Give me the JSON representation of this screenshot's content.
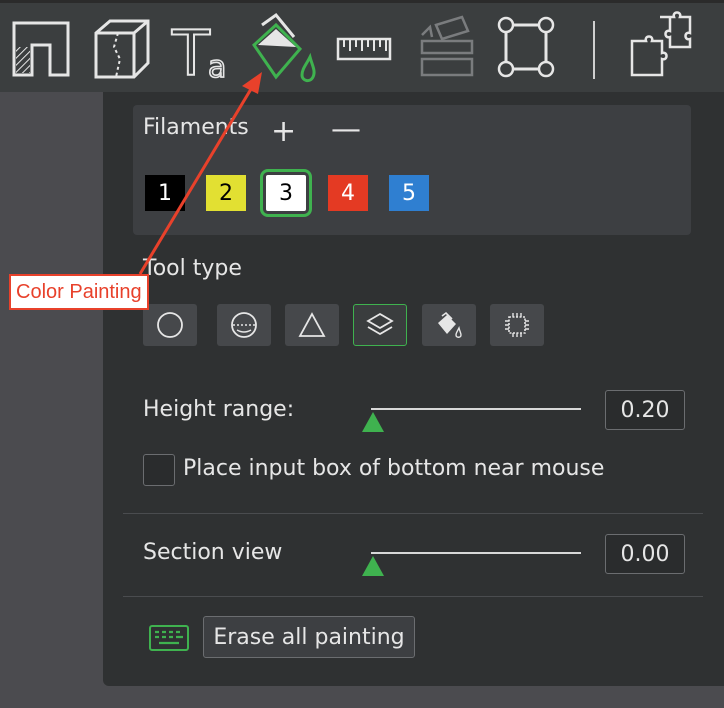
{
  "toolbar": {
    "tools": [
      {
        "name": "cut-tool",
        "icon": "cut-corner-icon"
      },
      {
        "name": "support-tool",
        "icon": "cube-seam-icon"
      },
      {
        "name": "text-tool",
        "icon": "text-ta-icon",
        "glyph_big": "T",
        "glyph_small": "a"
      },
      {
        "name": "color-painting-tool",
        "icon": "paint-bucket-icon",
        "active": true
      },
      {
        "name": "measure-tool",
        "icon": "ruler-icon"
      },
      {
        "name": "assembly-tool",
        "icon": "stacked-parts-icon"
      },
      {
        "name": "seam-tool",
        "icon": "frame-corners-icon"
      },
      {
        "name": "arrange-tool",
        "icon": "puzzle-icon"
      }
    ]
  },
  "panel": {
    "filaments": {
      "title": "Filaments",
      "add_label": "+",
      "remove_label": "—",
      "swatches": [
        {
          "label": "1",
          "bg": "#000000",
          "fg": "#ffffff",
          "selected": false
        },
        {
          "label": "2",
          "bg": "#e2e032",
          "fg": "#000000",
          "selected": false
        },
        {
          "label": "3",
          "bg": "#ffffff",
          "fg": "#000000",
          "selected": true
        },
        {
          "label": "4",
          "bg": "#e43a23",
          "fg": "#ffffff",
          "selected": false
        },
        {
          "label": "5",
          "bg": "#2f7fd1",
          "fg": "#ffffff",
          "selected": false
        }
      ]
    },
    "tool_type": {
      "label": "Tool type",
      "buttons": [
        {
          "name": "circle",
          "icon": "circle-icon",
          "active": false
        },
        {
          "name": "sphere",
          "icon": "sphere-icon",
          "active": false
        },
        {
          "name": "triangle",
          "icon": "triangle-icon",
          "active": false
        },
        {
          "name": "height-range",
          "icon": "layers-icon",
          "active": true
        },
        {
          "name": "fill",
          "icon": "fill-bucket-icon",
          "active": false
        },
        {
          "name": "gap-fill",
          "icon": "chip-icon",
          "active": false
        }
      ]
    },
    "height_range": {
      "label": "Height range:",
      "value": "0.20",
      "slider_fraction": 0.0
    },
    "checkbox": {
      "label": "Place input box of bottom near mouse",
      "checked": false
    },
    "section_view": {
      "label": "Section view",
      "value": "0.00",
      "slider_fraction": 0.0
    },
    "erase_button": {
      "label": "Erase all painting"
    }
  },
  "annotation": {
    "label": "Color Painting",
    "color": "#e8412b"
  },
  "colors": {
    "accent": "#3fb24f",
    "panel": "#2f3132",
    "toolbar": "#3b3e3f"
  }
}
